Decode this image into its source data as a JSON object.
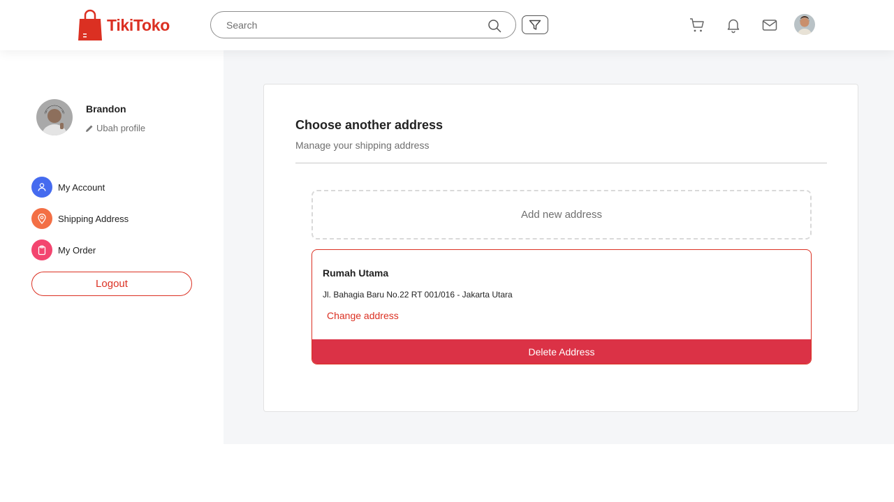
{
  "brand": {
    "name": "TikiToko",
    "color": "#db3022"
  },
  "search": {
    "placeholder": "Search"
  },
  "header_icons": [
    "cart-icon",
    "bell-icon",
    "mail-icon"
  ],
  "profile": {
    "name": "Brandon",
    "edit_label": "Ubah profile"
  },
  "sidebar": {
    "items": [
      {
        "label": "My Account",
        "icon": "user-icon",
        "color": "#456bef"
      },
      {
        "label": "Shipping Address",
        "icon": "map-pin-icon",
        "color": "#f36f45"
      },
      {
        "label": "My Order",
        "icon": "clipboard-icon",
        "color": "#f3456f"
      }
    ],
    "logout_label": "Logout"
  },
  "main": {
    "title": "Choose another address",
    "subtitle": "Manage your shipping address",
    "add_address_label": "Add new address",
    "address": {
      "name": "Rumah Utama",
      "line": "Jl. Bahagia Baru No.22 RT 001/016 - Jakarta Utara",
      "change_label": "Change address",
      "delete_label": "Delete Address"
    }
  }
}
